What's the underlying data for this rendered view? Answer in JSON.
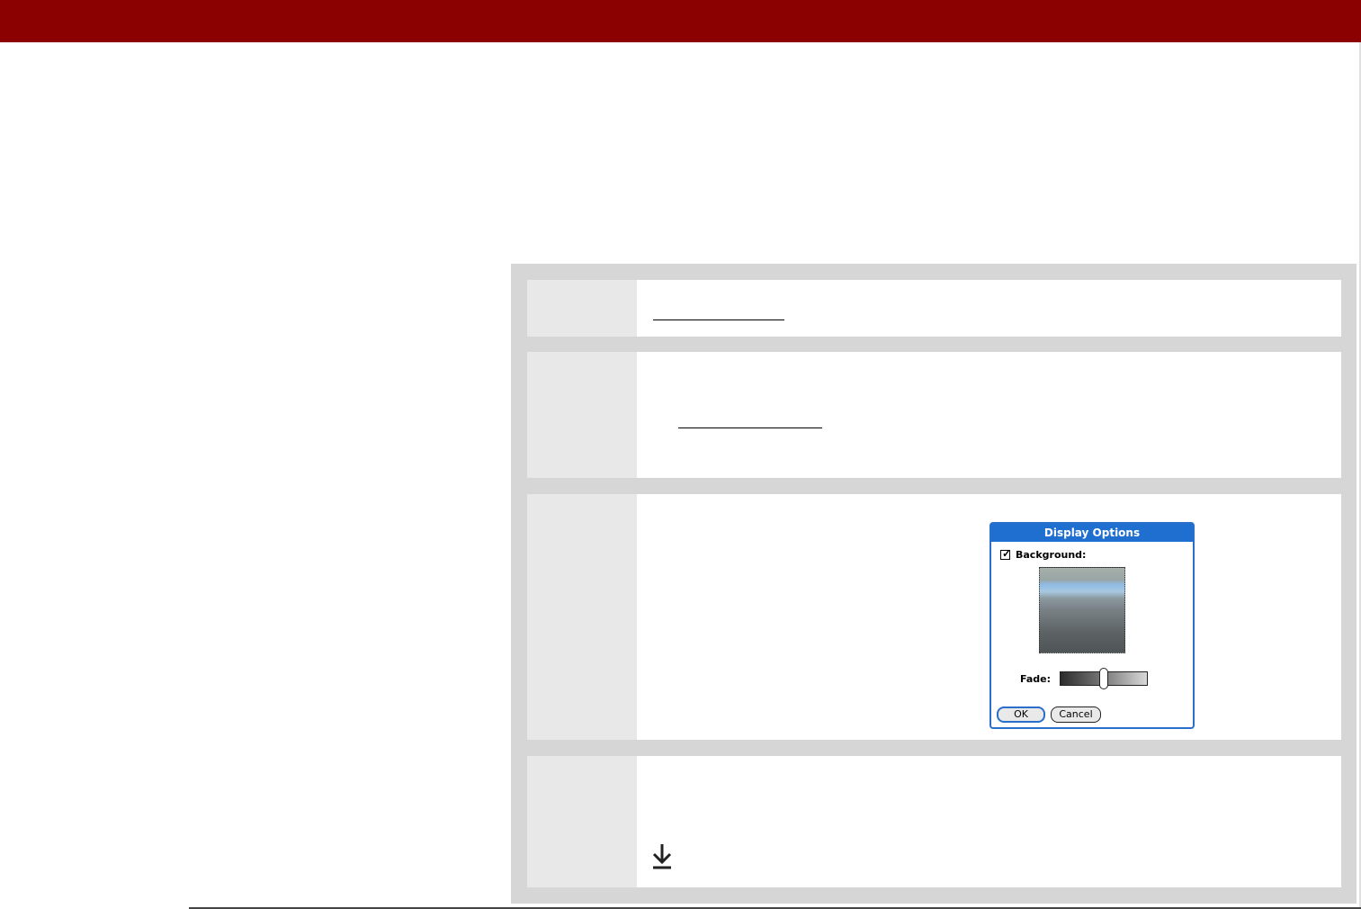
{
  "dialog": {
    "title": "Display Options",
    "background_label": "Background:",
    "background_checked": true,
    "checkbox_glyph": "✓",
    "fade_label": "Fade:",
    "fade_level_percent": 50,
    "ok_label": "OK",
    "cancel_label": "Cancel"
  },
  "icons": {
    "step4": "down-arrow-icon"
  },
  "colors": {
    "header_bar": "#8b0000",
    "dialog_title": "#1f6fd0",
    "procedure_frame": "#d6d6d6",
    "step_number_cell": "#e8e8e8"
  }
}
